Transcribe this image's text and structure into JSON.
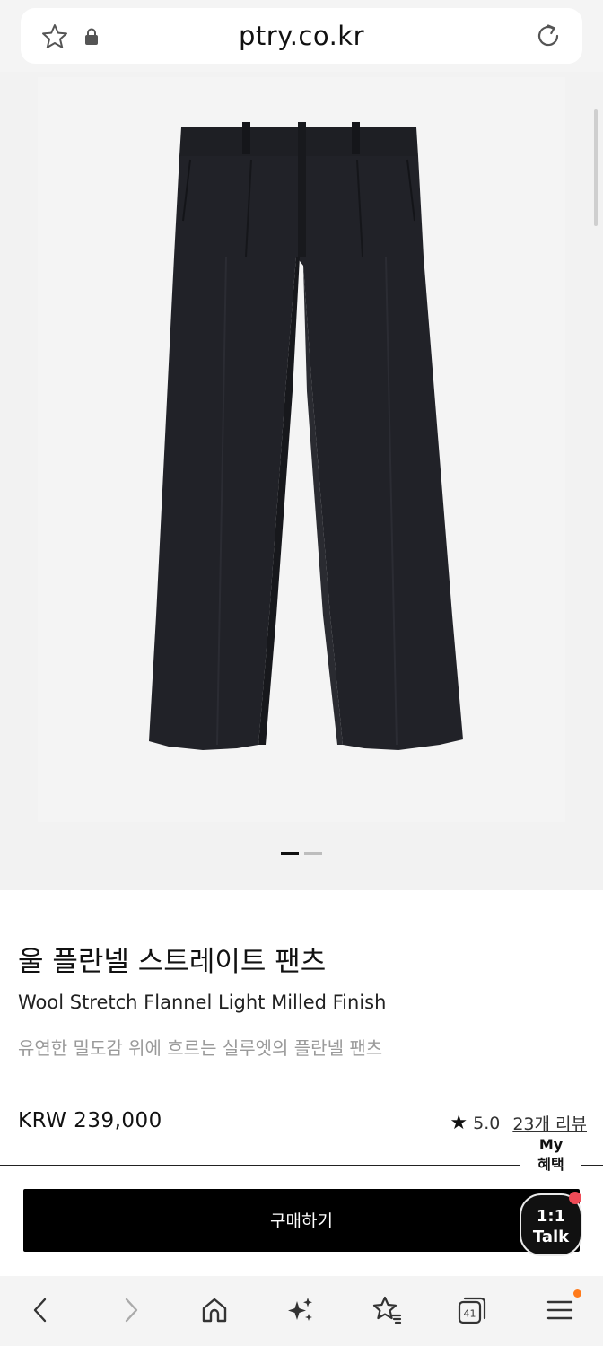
{
  "browser": {
    "url": "ptry.co.kr"
  },
  "product": {
    "title_ko": "울 플란넬 스트레이트 팬츠",
    "title_en": "Wool Stretch Flannel Light Milled Finish",
    "subtitle": "유연한 밀도감 위에 흐르는 실루엣의 플란넬 팬츠",
    "price": "KRW 239,000",
    "rating": "5.0",
    "review_count": "23개 리뷰",
    "image_alt": "black wide straight trousers"
  },
  "carousel": {
    "current": 1,
    "total": 2
  },
  "actions": {
    "buy_label": "구매하기",
    "my_benefit_line1": "My",
    "my_benefit_line2": "혜택",
    "talk_line1": "1:1",
    "talk_line2": "Talk"
  },
  "bottom_nav": {
    "tab_count": "41",
    "items": [
      "back-icon",
      "forward-icon",
      "home-icon",
      "sparkle-icon",
      "bookmark-star-icon",
      "tabs-icon",
      "menu-icon"
    ]
  },
  "colors": {
    "buy_button": "#000000",
    "notification_dot": "#ef4b57",
    "menu_badge": "#ff7a1a",
    "subtitle_text": "#9a9a9a"
  }
}
